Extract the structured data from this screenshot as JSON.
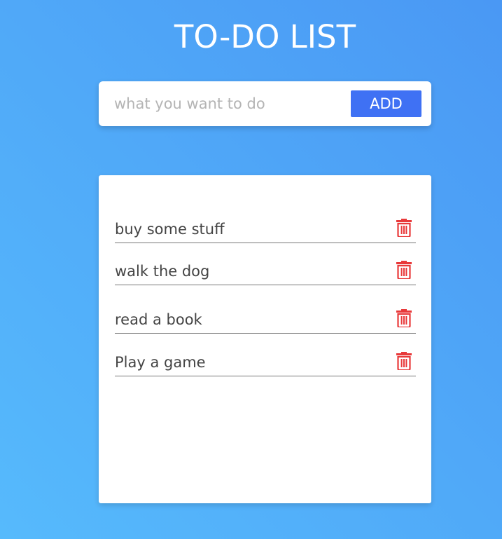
{
  "app": {
    "title": "TO-DO LIST"
  },
  "input": {
    "placeholder": "what you want to do",
    "value": ""
  },
  "add_button": {
    "label": "ADD"
  },
  "todos": [
    {
      "text": "buy some stuff",
      "icon": "trash-icon"
    },
    {
      "text": "walk the dog",
      "icon": "trash-icon"
    },
    {
      "text": "read a book",
      "icon": "trash-icon"
    },
    {
      "text": "Play a game",
      "icon": "trash-icon"
    }
  ],
  "colors": {
    "background_start": "#56bafc",
    "background_end": "#4a98f4",
    "accent": "#3f71f4",
    "delete": "#e8393a",
    "text": "#444444"
  }
}
